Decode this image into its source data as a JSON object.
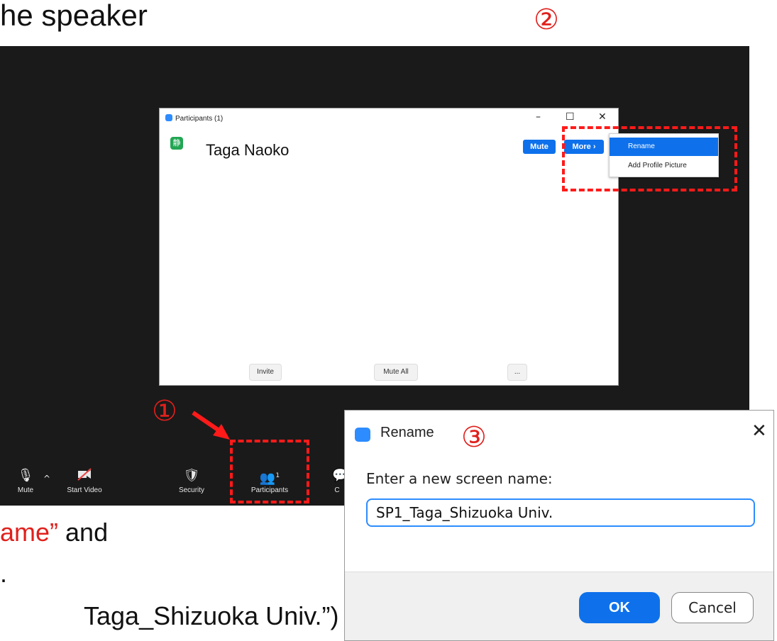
{
  "slide": {
    "heading_fragment": "he speaker",
    "line1_red": "ame”",
    "line1_rest": " and",
    "line2": ".",
    "line3": "Taga_Shizuoka Univ.”)"
  },
  "markers": {
    "step1": "①",
    "step2": "②",
    "step3": "③"
  },
  "participants_window": {
    "title": "Participants (1)",
    "participant_initial": "静",
    "participant_name": "Taga Naoko",
    "mute_label": "Mute",
    "more_label": "More ›",
    "footer": {
      "invite": "Invite",
      "mute_all": "Mute All",
      "more": "..."
    },
    "controls": {
      "minimize": "–",
      "maximize": "☐",
      "close": "✕"
    }
  },
  "context_menu": {
    "items": [
      "Rename",
      "Add Profile Picture"
    ],
    "active_index": 0
  },
  "toolbar": {
    "mute": "Mute",
    "start_video": "Start Video",
    "security": "Security",
    "participants": "Participants",
    "participants_count": "1",
    "chat_fragment": "C"
  },
  "rename_dialog": {
    "title": "Rename",
    "label": "Enter a new screen name:",
    "input_value": "SP1_Taga_Shizuoka Univ.",
    "ok_label": "OK",
    "cancel_label": "Cancel",
    "close_glyph": "✕"
  },
  "colors": {
    "accent": "#0e71eb",
    "highlight_red": "#ff1a1a",
    "screen_bg": "#1a1a1a"
  }
}
